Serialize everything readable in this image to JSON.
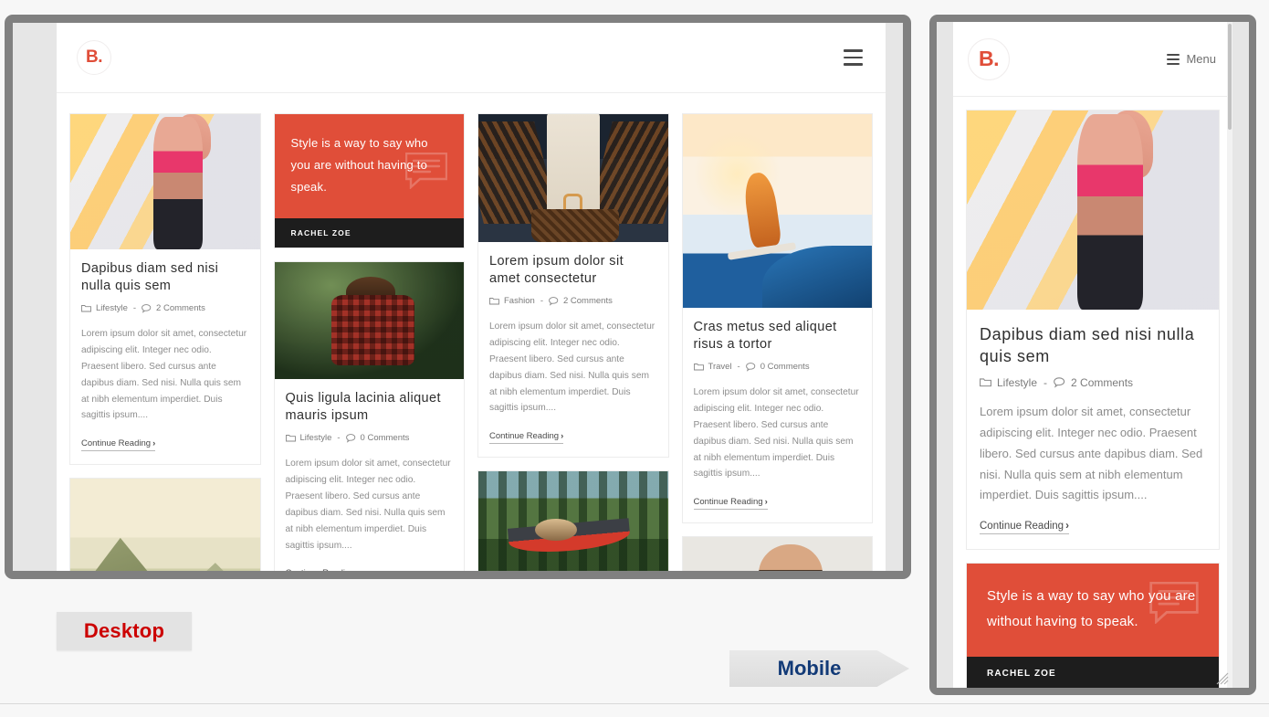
{
  "site": {
    "logo": "B.",
    "menu_label": "Menu",
    "menu_icon": "hamburger-icon"
  },
  "labels": {
    "desktop": "Desktop",
    "mobile": "Mobile",
    "desktop_color": "#cc0000",
    "mobile_color": "#123a77"
  },
  "theme": {
    "accent": "#e04e39",
    "quote_footer_bg": "#1d1d1d",
    "frame_border": "#808080",
    "page_bg": "#f7f7f7"
  },
  "common": {
    "excerpt": "Lorem ipsum dolor sit amet, consectetur adipiscing elit. Integer nec odio. Praesent libero. Sed cursus ante dapibus diam. Sed nisi. Nulla quis sem at nibh elementum imperdiet. Duis sagittis ipsum....",
    "continue_label": "Continue Reading",
    "continue_chevron": "›",
    "meta_separator": "-"
  },
  "quote": {
    "text": "Style is a way to say who you are without having to speak.",
    "author": "RACHEL ZOE",
    "icon": "speech-bubble-icon"
  },
  "posts": {
    "p1": {
      "title": "Dapibus diam sed nisi nulla quis sem",
      "category": "Lifestyle",
      "comments": "2 Comments",
      "image": "woman-running-crosswalk"
    },
    "p2": {
      "title": "Quis ligula lacinia aliquet mauris ipsum",
      "category": "Lifestyle",
      "comments": "0 Comments",
      "image": "woman-plaid-shirt-forest"
    },
    "p3": {
      "title": "Lorem ipsum dolor sit amet consectetur",
      "category": "Fashion",
      "comments": "2 Comments",
      "image": "woman-handbag-escalator"
    },
    "p4": {
      "title": "Cras metus sed aliquet risus a tortor",
      "category": "Travel",
      "comments": "0 Comments",
      "image": "surfer-sunset-wave"
    },
    "p5": {
      "image": "mountain-landscape-haze"
    },
    "p6": {
      "image": "hammock-forest-lake"
    },
    "p7": {
      "image": "bearded-man-portrait"
    },
    "p8": {
      "image": "sky-clouds"
    }
  },
  "desktop_grid": {
    "columns": [
      [
        "p1",
        "p5"
      ],
      [
        "quote",
        "p2",
        "p8"
      ],
      [
        "p3",
        "p6"
      ],
      [
        "p4",
        "p7"
      ]
    ]
  },
  "mobile_stack": [
    "p1",
    "quote"
  ]
}
